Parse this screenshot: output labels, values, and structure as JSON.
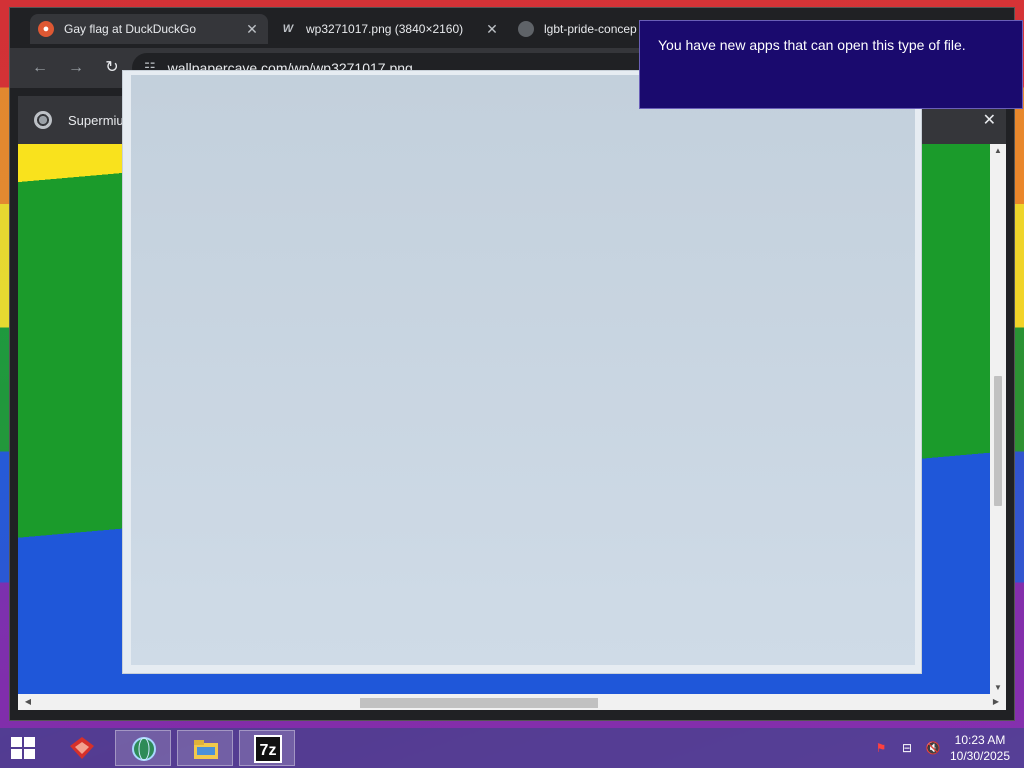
{
  "browser": {
    "tabs": [
      {
        "label": "Gay flag at DuckDuckGo",
        "active": true,
        "icon": "duckduckgo-icon",
        "close": "✕"
      },
      {
        "label": "wp3271017.png (3840×2160)",
        "active": false,
        "icon": "wallpapercave-icon",
        "close": "✕"
      },
      {
        "label": "lgbt-pride-concep",
        "active": false,
        "icon": "globe-icon"
      }
    ],
    "address": "wallpapercave.com/wp/wp3271017.png",
    "infobar": {
      "text": "Supermiu",
      "close": "✕"
    }
  },
  "toast": {
    "message": "You have new apps that can open this type of file."
  },
  "taskbar": {
    "apps": [
      "start-icon",
      "app-red-icon",
      "browser-globe-icon",
      "file-explorer-icon",
      "7zip-icon"
    ],
    "app_7zip_label": "7z",
    "clock": {
      "time": "10:23 AM",
      "date": "10/30/2025"
    },
    "tray_icons": [
      "action-center-flag-icon",
      "network-icon",
      "volume-muted-icon"
    ]
  },
  "colors": {
    "toast_bg": "#1a0a6e",
    "browser_frame": "#202124",
    "toolbar": "#35363a"
  }
}
